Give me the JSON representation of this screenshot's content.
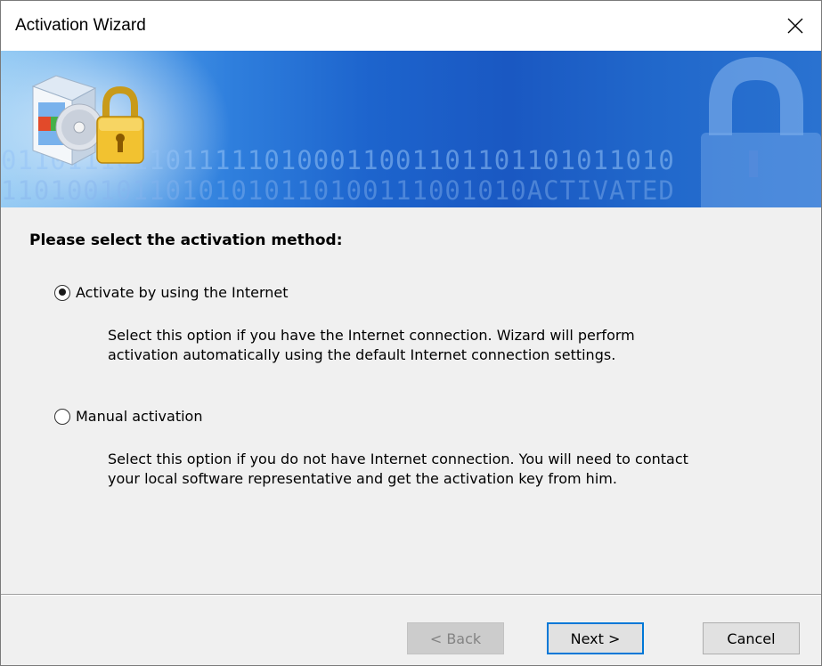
{
  "window": {
    "title": "Activation Wizard",
    "close_icon": "close-icon"
  },
  "banner": {
    "binary_row1": "01101110110111110100011001101101101011010",
    "binary_row2": "11010010110101010110100111001010ACTIVATED",
    "icons": [
      "software-box-icon",
      "padlock-icon",
      "watermark-lock-icon"
    ],
    "gradient_colors": [
      "#8fc8f3",
      "#2f7fdd",
      "#1a58c2"
    ]
  },
  "main": {
    "heading": "Please select the activation method:",
    "options": [
      {
        "label": "Activate by using the Internet",
        "selected": true,
        "description_line1": "Select this option if you have the Internet connection. Wizard will perform",
        "description_line2": "activation automatically using the default Internet connection settings."
      },
      {
        "label": "Manual activation",
        "selected": false,
        "description_line1": "Select this option if you do not have Internet connection. You will need to contact",
        "description_line2": "your local software representative and get the activation key from him."
      }
    ]
  },
  "footer": {
    "back_label": "< Back",
    "back_enabled": false,
    "next_label": "Next >",
    "cancel_label": "Cancel",
    "accent_color": "#0078d7"
  }
}
